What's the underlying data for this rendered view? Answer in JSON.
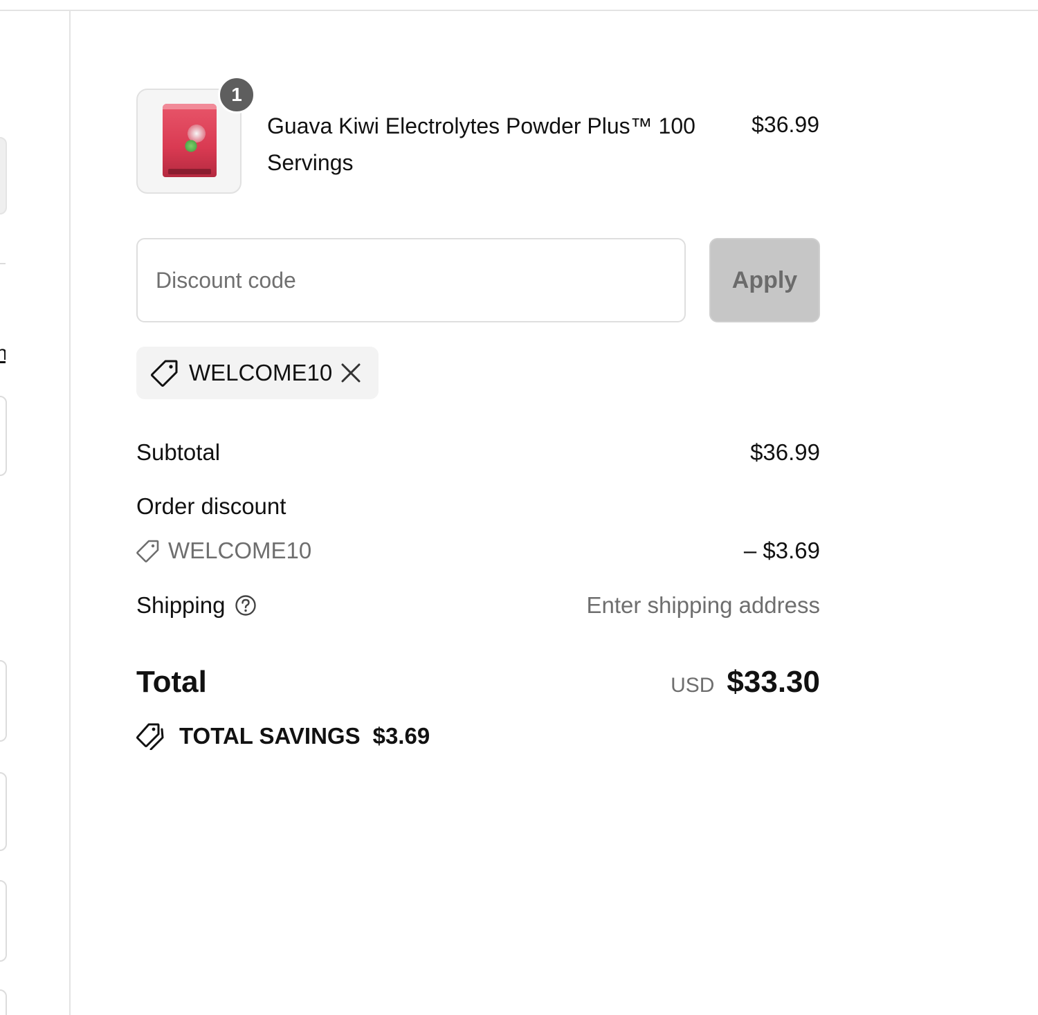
{
  "left_fragment_text": "n",
  "product": {
    "quantity": "1",
    "name": "Guava Kiwi Electrolytes Powder Plus™ 100 Servings",
    "price": "$36.99",
    "image_icon": "product-pouch-image"
  },
  "discount": {
    "placeholder": "Discount code",
    "value": "",
    "apply_label": "Apply",
    "applied_code": "WELCOME10"
  },
  "summary": {
    "subtotal_label": "Subtotal",
    "subtotal_value": "$36.99",
    "order_discount_label": "Order discount",
    "order_discount_code": "WELCOME10",
    "order_discount_value": "– $3.69",
    "shipping_label": "Shipping",
    "shipping_value": "Enter shipping address",
    "total_label": "Total",
    "currency": "USD",
    "total_value": "$33.30",
    "savings_label": "TOTAL SAVINGS",
    "savings_value": "$3.69"
  },
  "colors": {
    "badge": "#5e5e5e",
    "apply_button_bg": "#c6c6c6",
    "chip_bg": "#f3f3f3",
    "muted_text": "#6e6e6e"
  }
}
